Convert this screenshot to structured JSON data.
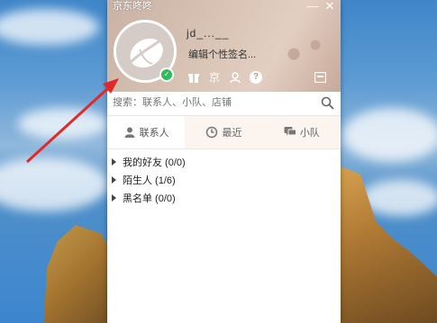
{
  "window": {
    "title": "京东咚咚",
    "minimize": "—",
    "close": "✕"
  },
  "profile": {
    "nickname": "jd_...__",
    "signature": "编辑个性签名..."
  },
  "toolbar": {
    "icons": [
      "gift-icon",
      "jd-icon",
      "contact-icon",
      "help-icon",
      "message-icon"
    ],
    "jd_label": "京",
    "help_label": "?"
  },
  "search": {
    "placeholder": "搜索：联系人、小队、店铺"
  },
  "tabs": [
    {
      "label": "联系人",
      "icon": "person-icon",
      "active": true
    },
    {
      "label": "最近",
      "icon": "clock-icon",
      "active": false
    },
    {
      "label": "小队",
      "icon": "chat-icon",
      "active": false
    }
  ],
  "groups": [
    {
      "label": "我的好友 (0/0)"
    },
    {
      "label": "陌生人 (1/6)"
    },
    {
      "label": "黑名单 (0/0)"
    }
  ],
  "colors": {
    "arrow": "#e02a2a",
    "online": "#2dbb5c",
    "header_bg": "#d7c2b3"
  }
}
